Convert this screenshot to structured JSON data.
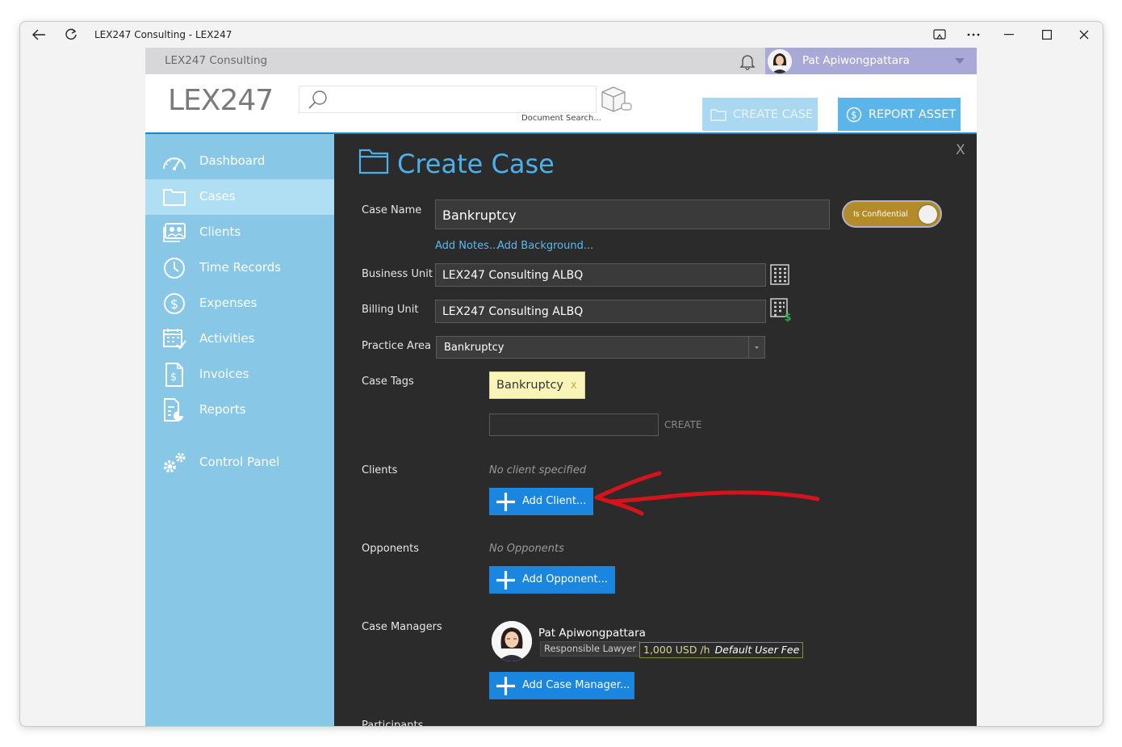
{
  "window": {
    "title": "LEX247 Consulting - LEX247"
  },
  "topbar": {
    "org_name": "LEX247 Consulting",
    "user_name": "Pat Apiwongpattara"
  },
  "header": {
    "logo_text": "LEX247",
    "search_placeholder": "",
    "search_label": "Document Search...",
    "create_case_label": "CREATE CASE",
    "report_asset_label": "REPORT ASSET"
  },
  "sidebar": {
    "items": [
      {
        "label": "Dashboard",
        "icon": "dashboard-icon",
        "active": false
      },
      {
        "label": "Cases",
        "icon": "folder-icon",
        "active": true
      },
      {
        "label": "Clients",
        "icon": "clients-icon",
        "active": false
      },
      {
        "label": "Time Records",
        "icon": "clock-icon",
        "active": false
      },
      {
        "label": "Expenses",
        "icon": "dollar-icon",
        "active": false
      },
      {
        "label": "Activities",
        "icon": "calendar-icon",
        "active": false
      },
      {
        "label": "Invoices",
        "icon": "invoice-icon",
        "active": false
      },
      {
        "label": "Reports",
        "icon": "report-icon",
        "active": false
      },
      {
        "label": "Control Panel",
        "icon": "gears-icon",
        "active": false
      }
    ]
  },
  "form": {
    "title": "Create Case",
    "close_label": "X",
    "case_name_label": "Case Name",
    "case_name_value": "Bankruptcy",
    "confidential_label": "Is Confidential",
    "add_notes_link": "Add Notes...",
    "add_background_link": "Add Background...",
    "business_unit_label": "Business Unit",
    "business_unit_value": "LEX247 Consulting ALBQ",
    "billing_unit_label": "Billing Unit",
    "billing_unit_value": "LEX247 Consulting ALBQ",
    "practice_area_label": "Practice Area",
    "practice_area_value": "Bankruptcy",
    "case_tags_label": "Case Tags",
    "tag_value": "Bankruptcy",
    "tag_remove": "X",
    "tag_create_label": "CREATE",
    "clients_label": "Clients",
    "clients_empty": "No client specified",
    "add_client_label": "Add Client...",
    "opponents_label": "Opponents",
    "opponents_empty": "No Opponents",
    "add_opponent_label": "Add Opponent...",
    "case_managers_label": "Case Managers",
    "manager_name": "Pat Apiwongpattara",
    "manager_role": "Responsible Lawyer",
    "manager_fee": "1,000 USD /h",
    "manager_fee_note": "Default User Fee",
    "add_case_manager_label": "Add Case Manager...",
    "participants_label": "Participants"
  },
  "colors": {
    "accent_blue": "#1a86e0",
    "sidebar_bg": "#88c8e6",
    "main_bg": "#2b2b2b",
    "annotation_arrow": "#d4141c"
  }
}
